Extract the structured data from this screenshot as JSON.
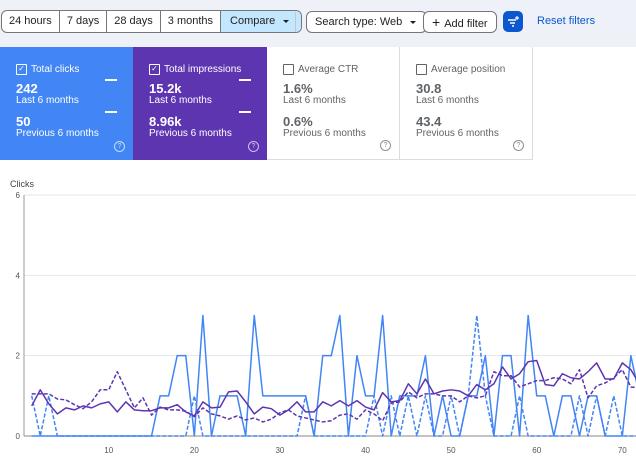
{
  "toolbar": {
    "ranges": [
      "24 hours",
      "7 days",
      "28 days",
      "3 months"
    ],
    "compare_label": "Compare",
    "search_type_label": "Search type: Web",
    "add_filter_label": "Add filter",
    "reset_filters_label": "Reset filters"
  },
  "cards": [
    {
      "label": "Total clicks",
      "checked": true,
      "value": "242",
      "period": "Last 6 months",
      "prev_value": "50",
      "prev_period": "Previous 6 months",
      "color": "#4285f4"
    },
    {
      "label": "Total impressions",
      "checked": true,
      "value": "15.2k",
      "period": "Last 6 months",
      "prev_value": "8.96k",
      "prev_period": "Previous 6 months",
      "color": "#5e35b1"
    },
    {
      "label": "Average CTR",
      "checked": false,
      "value": "1.6%",
      "period": "Last 6 months",
      "prev_value": "0.6%",
      "prev_period": "Previous 6 months"
    },
    {
      "label": "Average position",
      "checked": false,
      "value": "30.8",
      "period": "Last 6 months",
      "prev_value": "43.4",
      "prev_period": "Previous 6 months"
    }
  ],
  "chart_data": {
    "type": "line",
    "ylabel": "Clicks",
    "ylim": [
      0,
      6
    ],
    "yticks": [
      "0",
      "2",
      "4",
      "6"
    ],
    "xticks": [
      "10",
      "20",
      "30",
      "40",
      "50",
      "60",
      "70"
    ],
    "xlim": [
      0.1,
      71.6
    ],
    "grid": true,
    "series": [
      {
        "metric": "clicks",
        "period": "current",
        "style": "solid",
        "color": "#4285f4",
        "values": [
          0,
          0,
          0,
          0,
          0,
          0,
          0,
          0,
          0,
          0,
          0,
          0,
          0,
          0,
          0,
          1,
          1,
          2,
          2,
          0,
          3,
          0,
          1,
          1,
          1,
          0,
          3,
          1,
          1,
          1,
          1,
          1,
          1,
          0,
          2,
          2,
          3,
          0,
          2,
          1,
          1,
          3,
          0,
          1,
          1,
          1,
          2,
          0,
          1,
          0,
          0,
          1,
          1,
          2,
          0,
          2,
          2,
          0,
          3,
          1,
          1,
          0,
          1,
          1,
          0,
          1,
          1,
          0,
          0,
          0,
          2,
          1
        ]
      },
      {
        "metric": "clicks",
        "period": "previous",
        "style": "dashed",
        "color": "#4285f4",
        "values": [
          1,
          0,
          1,
          0,
          0,
          0,
          0,
          0,
          0,
          0,
          0,
          0,
          0,
          0,
          0,
          0,
          0,
          0,
          0,
          1,
          0,
          0,
          0,
          0,
          0,
          0,
          0,
          0,
          0,
          0,
          0,
          0,
          1,
          0,
          0,
          0,
          0,
          0,
          0,
          0,
          1,
          0,
          1,
          0,
          1,
          0,
          1,
          0,
          0,
          1,
          0,
          1,
          3,
          1,
          0,
          0,
          0,
          1,
          0,
          0,
          0,
          0,
          0,
          0,
          1,
          0,
          1,
          0,
          1,
          0,
          0,
          0
        ]
      },
      {
        "metric": "impressions",
        "period": "current",
        "style": "solid",
        "color": "#5e35b1",
        "values": [
          0.75,
          1.15,
          0.8,
          0.55,
          0.7,
          0.65,
          0.75,
          0.7,
          0.8,
          0.85,
          0.6,
          0.85,
          0.65,
          0.63,
          0.63,
          0.7,
          0.7,
          0.78,
          0.6,
          0.5,
          0.85,
          0.7,
          0.72,
          1.1,
          1.12,
          0.85,
          0.55,
          0.72,
          0.68,
          0.52,
          0.65,
          0.85,
          0.6,
          0.6,
          0.85,
          0.75,
          0.88,
          0.75,
          0.88,
          0.72,
          0.65,
          1.08,
          0.85,
          0.88,
          1.3,
          1.05,
          1.42,
          1.05,
          1.12,
          1.15,
          1.12,
          1.0,
          1.28,
          1.15,
          1.3,
          1.72,
          1.42,
          1.55,
          1.85,
          1.88,
          1.28,
          1.25,
          1.55,
          1.45,
          1.42,
          1.6,
          1.82,
          1.42,
          1.42,
          1.82,
          1.65,
          1.3
        ]
      },
      {
        "metric": "impressions",
        "period": "previous",
        "style": "dashed",
        "color": "#5e35b1",
        "values": [
          1.05,
          1.05,
          1.05,
          0.92,
          0.9,
          0.78,
          0.68,
          0.85,
          1.15,
          1.15,
          1.6,
          1.15,
          0.7,
          0.95,
          0.52,
          0.72,
          0.65,
          0.65,
          0.62,
          0.48,
          0.7,
          0.55,
          0.5,
          0.42,
          0.5,
          0.4,
          0.45,
          0.35,
          0.42,
          0.58,
          0.65,
          0.5,
          0.45,
          0.4,
          0.35,
          0.38,
          0.52,
          0.55,
          0.42,
          0.65,
          0.55,
          0.38,
          0.82,
          0.85,
          1.1,
          0.95,
          1.05,
          1.05,
          1.0,
          1.0,
          0.85,
          1.0,
          0.95,
          1.0,
          1.6,
          1.5,
          1.5,
          1.22,
          1.3,
          1.38,
          1.38,
          1.45,
          1.42,
          1.3,
          1.65,
          0.95,
          1.25,
          1.32,
          1.45,
          1.65,
          1.22,
          1.2
        ]
      }
    ]
  }
}
